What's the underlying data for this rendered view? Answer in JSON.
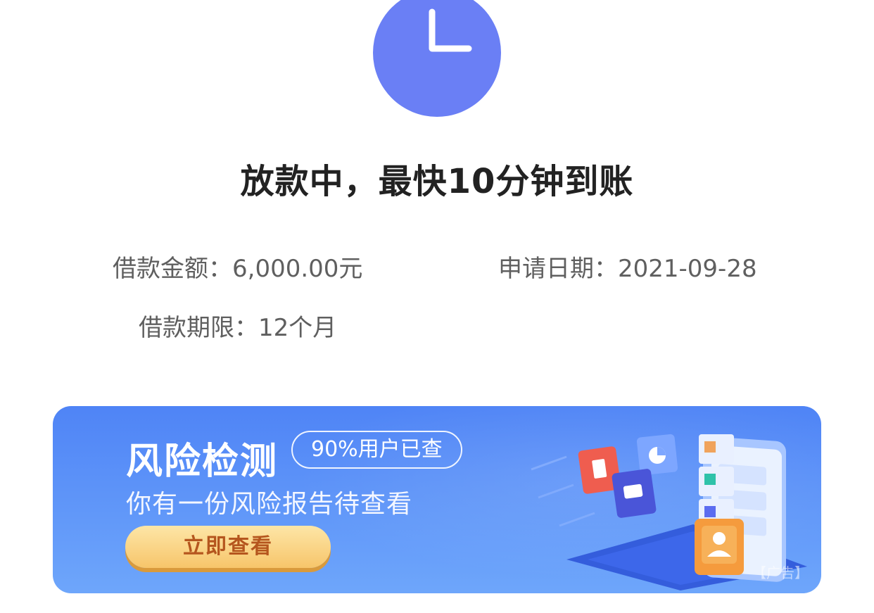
{
  "status": {
    "icon": "clock-icon",
    "title": "放款中，最快10分钟到账"
  },
  "loan": {
    "amount_label": "借款金额：",
    "amount_value": "6,000.00元",
    "date_label": "申请日期：",
    "date_value": "2021-09-28",
    "term_label": "借款期限：",
    "term_value": "12个月"
  },
  "banner": {
    "heading": "风险检测",
    "badge": "90%用户已查",
    "subtitle": "你有一份风险报告待查看",
    "cta": "立即查看",
    "ad_tag": "【广告】"
  },
  "colors": {
    "status_icon": "#6a7ff5",
    "banner_top": "#4f84f6",
    "banner_bottom": "#6ea6fb",
    "cta_bg": "#f7c56a",
    "cta_text": "#b5561e"
  }
}
